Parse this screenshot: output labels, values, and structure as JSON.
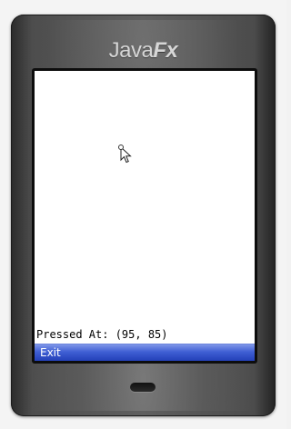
{
  "device": {
    "brand_prefix": "Java",
    "brand_suffix": "Fx"
  },
  "screen": {
    "status_text": "Pressed At: (95, 85)",
    "cursor_icon": "arrow-cursor-icon"
  },
  "softkeys": {
    "left_label": "Exit",
    "bar_color": "#3554cc"
  }
}
